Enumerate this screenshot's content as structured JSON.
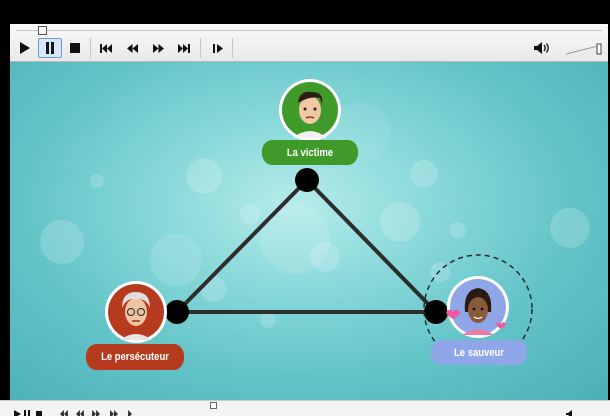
{
  "player": {
    "controls": {
      "play": "play-icon",
      "pause": "pause-icon",
      "stop": "stop-icon",
      "previous": "skip-previous-icon",
      "rewind": "rewind-icon",
      "forward": "fast-forward-icon",
      "next": "skip-next-icon",
      "frame": "frame-step-icon",
      "volume": "speaker-icon"
    },
    "colors": {
      "active_button": "#d8e8fb",
      "active_border": "#6b9bd6"
    }
  },
  "diagram": {
    "nodes": [
      {
        "label": "La victime",
        "color": "#3f9a2a"
      },
      {
        "label": "Le persécuteur",
        "color": "#b63a1e"
      },
      {
        "label": "Le sauveur",
        "color": "#8fa7e8"
      }
    ],
    "colors": {
      "background": "#7fd3d5",
      "edges": "#2d2d2d",
      "vertices": "#000000"
    }
  }
}
